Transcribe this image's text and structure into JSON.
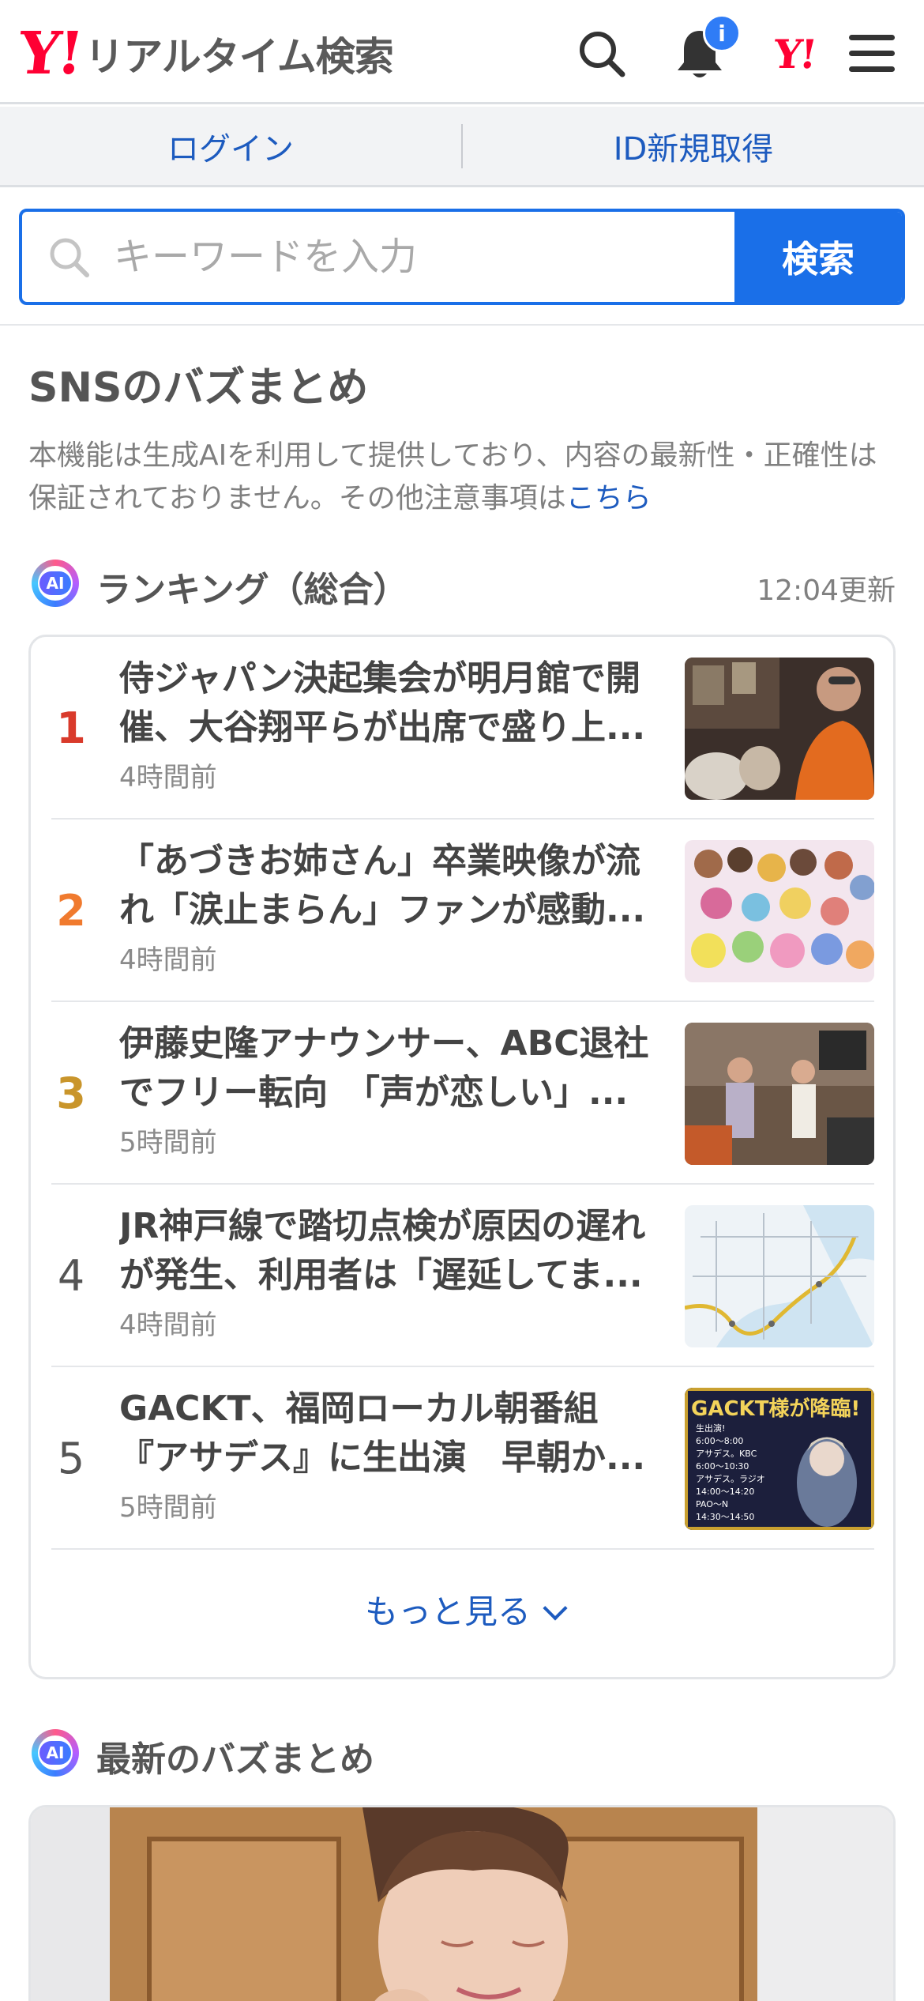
{
  "header": {
    "logo_mark": "Y!",
    "logo_text": "リアルタイム検索",
    "notification_count": "i",
    "yahoo_mark": "Y!"
  },
  "account": {
    "login_label": "ログイン",
    "signup_label": "ID新規取得"
  },
  "search": {
    "placeholder": "キーワードを入力",
    "button_label": "検索"
  },
  "buzz": {
    "title": "SNSのバズまとめ",
    "notice": "本機能は生成AIを利用して提供しており、内容の最新性・正確性は保証されておりません。その他注意事項は",
    "notice_link": "こちら"
  },
  "ranking": {
    "ai_label": "AI",
    "title": "ランキング（総合）",
    "updated": "12:04更新",
    "items": [
      {
        "rank": "1",
        "title": "侍ジャパン決起集会が明月館で開催、大谷翔平らが出席で盛り上...",
        "time": "4時間前",
        "color": "#d93a2b"
      },
      {
        "rank": "2",
        "title": "「あづきお姉さん」卒業映像が流れ「涙止まらん」ファンが感動...",
        "time": "4時間前",
        "color": "#f07a2e"
      },
      {
        "rank": "3",
        "title": "伊藤史隆アナウンサー、ABC退社でフリー転向　「声が恋しい」...",
        "time": "5時間前",
        "color": "#c9952b"
      },
      {
        "rank": "4",
        "title": "JR神戸線で踏切点検が原因の遅れが発生、利用者は「遅延してま...",
        "time": "4時間前",
        "color": "#555555"
      },
      {
        "rank": "5",
        "title": "GACKT、福岡ローカル朝番組『アサデス』に生出演　早朝か...",
        "time": "5時間前",
        "color": "#555555"
      }
    ],
    "more_label": "もっと見る"
  },
  "latest": {
    "ai_label": "AI",
    "title": "最新のバズまとめ"
  },
  "thumb5": {
    "headline": "GACKT様が降臨!",
    "lines": [
      "生出演!",
      "6:00〜8:00",
      "アサデス。KBC",
      "6:00〜10:30",
      "アサデス。ラジオ",
      "14:00〜14:20",
      "PAO〜N",
      "14:30〜14:50"
    ]
  }
}
